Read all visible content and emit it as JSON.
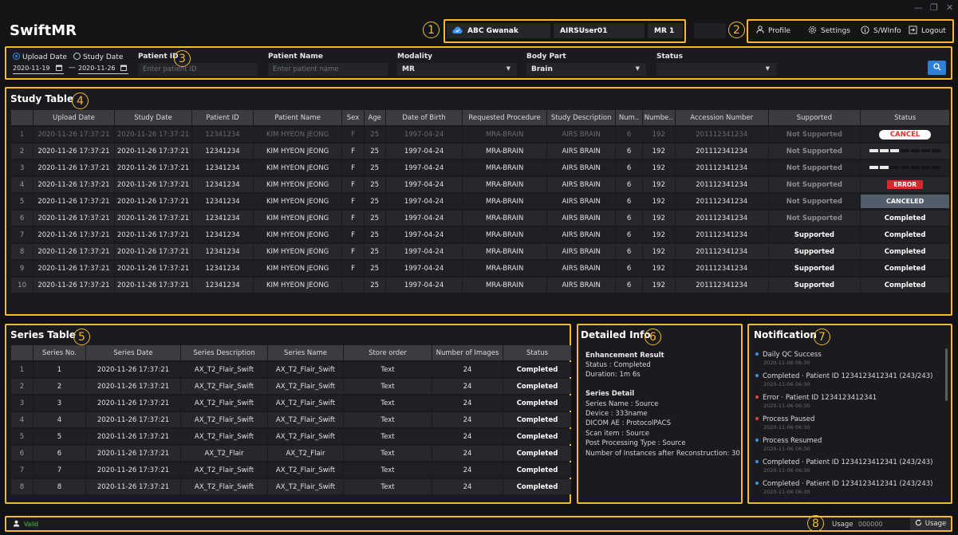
{
  "app": {
    "title": "SwiftMR"
  },
  "window": {
    "minimize": "—",
    "maximize": "❐",
    "close": "✕"
  },
  "header": {
    "hospital": "ABC Gwanak",
    "user": "AIRSUser01",
    "device": "MR 1",
    "profile": "Profile",
    "settings": "Settings",
    "swinfo": "S/WInfo",
    "logout": "Logout"
  },
  "callouts": [
    "1",
    "2",
    "3",
    "4",
    "5",
    "6",
    "7",
    "8"
  ],
  "filter": {
    "upload_date": "Upload Date",
    "study_date": "Study Date",
    "date_from": "2020-11-19",
    "date_to": "2020-11-26",
    "date_sep": "—",
    "patient_id_label": "Patient ID",
    "patient_id_placeholder": "Enter patient ID",
    "patient_name_label": "Patient Name",
    "patient_name_placeholder": "Enter patient name",
    "modality_label": "Modality",
    "modality_value": "MR",
    "body_part_label": "Body Part",
    "body_part_value": "Brain",
    "status_label": "Status",
    "status_value": ""
  },
  "study": {
    "title": "Study Table",
    "columns": [
      "",
      "Upload Date",
      "Study Date",
      "Patient ID",
      "Patient Name",
      "Sex",
      "Age",
      "Date of Birth",
      "Requested Procedure",
      "Study Description",
      "Num..",
      "Numbe..",
      "Accession Number",
      "Supported",
      "Status"
    ],
    "rows": [
      {
        "n": "1",
        "upload": "2020-11-26 17:37:21",
        "study": "2020-11-26 17:37:21",
        "pid": "12341234",
        "name": "KIM HYEON JEONG",
        "sex": "F",
        "age": "25",
        "dob": "1997-04-24",
        "proc": "MRA-BRAIN",
        "desc": "AIRS BRAIN",
        "num1": "6",
        "num2": "192",
        "acc": "201112341234",
        "supported": "Not Supported",
        "status": "CANCEL"
      },
      {
        "n": "2",
        "upload": "2020-11-26 17:37:21",
        "study": "2020-11-26 17:37:21",
        "pid": "12341234",
        "name": "KIM HYEON JEONG",
        "sex": "F",
        "age": "25",
        "dob": "1997-04-24",
        "proc": "MRA-BRAIN",
        "desc": "AIRS BRAIN",
        "num1": "6",
        "num2": "192",
        "acc": "201112341234",
        "supported": "Not Supported",
        "status": ""
      },
      {
        "n": "3",
        "upload": "2020-11-26 17:37:21",
        "study": "2020-11-26 17:37:21",
        "pid": "12341234",
        "name": "KIM HYEON JEONG",
        "sex": "F",
        "age": "25",
        "dob": "1997-04-24",
        "proc": "MRA-BRAIN",
        "desc": "AIRS BRAIN",
        "num1": "6",
        "num2": "192",
        "acc": "201112341234",
        "supported": "Not Supported",
        "status": ""
      },
      {
        "n": "4",
        "upload": "2020-11-26 17:37:21",
        "study": "2020-11-26 17:37:21",
        "pid": "12341234",
        "name": "KIM HYEON JEONG",
        "sex": "F",
        "age": "25",
        "dob": "1997-04-24",
        "proc": "MRA-BRAIN",
        "desc": "AIRS BRAIN",
        "num1": "6",
        "num2": "192",
        "acc": "201112341234",
        "supported": "Not Supported",
        "status": "ERROR"
      },
      {
        "n": "5",
        "upload": "2020-11-26 17:37:21",
        "study": "2020-11-26 17:37:21",
        "pid": "12341234",
        "name": "KIM HYEON JEONG",
        "sex": "F",
        "age": "25",
        "dob": "1997-04-24",
        "proc": "MRA-BRAIN",
        "desc": "AIRS BRAIN",
        "num1": "6",
        "num2": "192",
        "acc": "201112341234",
        "supported": "Not Supported",
        "status": "CANCELED"
      },
      {
        "n": "6",
        "upload": "2020-11-26 17:37:21",
        "study": "2020-11-26 17:37:21",
        "pid": "12341234",
        "name": "KIM HYEON JEONG",
        "sex": "F",
        "age": "25",
        "dob": "1997-04-24",
        "proc": "MRA-BRAIN",
        "desc": "AIRS BRAIN",
        "num1": "6",
        "num2": "192",
        "acc": "201112341234",
        "supported": "Not Supported",
        "status": "Completed"
      },
      {
        "n": "7",
        "upload": "2020-11-26 17:37:21",
        "study": "2020-11-26 17:37:21",
        "pid": "12341234",
        "name": "KIM HYEON JEONG",
        "sex": "F",
        "age": "25",
        "dob": "1997-04-24",
        "proc": "MRA-BRAIN",
        "desc": "AIRS BRAIN",
        "num1": "6",
        "num2": "192",
        "acc": "201112341234",
        "supported": "Supported",
        "status": "Completed"
      },
      {
        "n": "8",
        "upload": "2020-11-26 17:37:21",
        "study": "2020-11-26 17:37:21",
        "pid": "12341234",
        "name": "KIM HYEON JEONG",
        "sex": "F",
        "age": "25",
        "dob": "1997-04-24",
        "proc": "MRA-BRAIN",
        "desc": "AIRS BRAIN",
        "num1": "6",
        "num2": "192",
        "acc": "201112341234",
        "supported": "Supported",
        "status": "Completed"
      },
      {
        "n": "9",
        "upload": "2020-11-26 17:37:21",
        "study": "2020-11-26 17:37:21",
        "pid": "12341234",
        "name": "KIM HYEON JEONG",
        "sex": "F",
        "age": "25",
        "dob": "1997-04-24",
        "proc": "MRA-BRAIN",
        "desc": "AIRS BRAIN",
        "num1": "6",
        "num2": "192",
        "acc": "201112341234",
        "supported": "Supported",
        "status": "Completed"
      },
      {
        "n": "10",
        "upload": "2020-11-26 17:37:21",
        "study": "2020-11-26 17:37:21",
        "pid": "12341234",
        "name": "KIM HYEON JEONG",
        "sex": "",
        "age": "25",
        "dob": "1997-04-24",
        "proc": "MRA-BRAIN",
        "desc": "AIRS BRAIN",
        "num1": "6",
        "num2": "192",
        "acc": "201112341234",
        "supported": "Supported",
        "status": "Completed"
      }
    ],
    "progress": {
      "2": 0.4,
      "3": 0.25
    }
  },
  "series": {
    "title": "Series Table",
    "columns": [
      "",
      "Series No.",
      "Series Date",
      "Series Description",
      "Series Name",
      "Store order",
      "Number of Images",
      "Status"
    ],
    "rows": [
      {
        "n": "1",
        "no": "1",
        "date": "2020-11-26 17:37:21",
        "desc": "AX_T2_Flair_Swift",
        "name": "AX_T2_Flair_Swift",
        "order": "Text",
        "images": "24",
        "status": "Completed"
      },
      {
        "n": "2",
        "no": "2",
        "date": "2020-11-26 17:37:21",
        "desc": "AX_T2_Flair_Swift",
        "name": "AX_T2_Flair_Swift",
        "order": "Text",
        "images": "24",
        "status": "Completed"
      },
      {
        "n": "3",
        "no": "3",
        "date": "2020-11-26 17:37:21",
        "desc": "AX_T2_Flair_Swift",
        "name": "AX_T2_Flair_Swift",
        "order": "Text",
        "images": "24",
        "status": "Completed"
      },
      {
        "n": "4",
        "no": "4",
        "date": "2020-11-26 17:37:21",
        "desc": "AX_T2_Flair_Swift",
        "name": "AX_T2_Flair_Swift",
        "order": "Text",
        "images": "24",
        "status": "Completed"
      },
      {
        "n": "5",
        "no": "5",
        "date": "2020-11-26 17:37:21",
        "desc": "AX_T2_Flair_Swift",
        "name": "AX_T2_Flair_Swift",
        "order": "Text",
        "images": "24",
        "status": "Completed"
      },
      {
        "n": "6",
        "no": "6",
        "date": "2020-11-26 17:37:21",
        "desc": "AX_T2_Flair",
        "name": "AX_T2_Flair",
        "order": "Text",
        "images": "24",
        "status": "Completed"
      },
      {
        "n": "7",
        "no": "7",
        "date": "2020-11-26 17:37:21",
        "desc": "AX_T2_Flair_Swift",
        "name": "AX_T2_Flair_Swift",
        "order": "Text",
        "images": "24",
        "status": "Completed"
      },
      {
        "n": "8",
        "no": "8",
        "date": "2020-11-26 17:37:21",
        "desc": "AX_T2_Flair_Swift",
        "name": "AX_T2_Flair_Swift",
        "order": "Text",
        "images": "24",
        "status": "Completed"
      }
    ]
  },
  "detail": {
    "title": "Detailed Info",
    "enh_head": "Enhancement Result",
    "enh_status": "Status : Completed",
    "enh_duration": "Duration: 1m 6s",
    "series_head": "Series Detail",
    "series_name": "Series Name : Source",
    "device": "Device : 333name",
    "dicom_ae": "DICOM AE : ProtocolPACS",
    "scan_item": "Scan item : Source",
    "post_type": "Post Processing Type : Source",
    "instances": "Number of Instances after Reconstruction: 30"
  },
  "notification": {
    "title": "Notification",
    "items": [
      {
        "text": "Daily QC Success",
        "time": "2020-11-06 06:30",
        "color": "#3d8fe0"
      },
      {
        "text": "Completed · Patient ID 1234123412341 (243/243)",
        "time": "2020-11-06 06:30",
        "color": "#3d8fe0"
      },
      {
        "text": "Error · Patient ID 1234123412341",
        "time": "2020-11-06 06:30",
        "color": "#e0443e"
      },
      {
        "text": "Process Paused",
        "time": "2020-11-06 06:30",
        "color": "#e0443e"
      },
      {
        "text": "Process Resumed",
        "time": "2020-11-06 06:30",
        "color": "#3d8fe0"
      },
      {
        "text": "Completed · Patient ID 1234123412341 (243/243)",
        "time": "2020-11-06 06:30",
        "color": "#3d8fe0"
      },
      {
        "text": "Completed · Patient ID 1234123412341 (243/243)",
        "time": "2020-11-06 06:30",
        "color": "#3d8fe0"
      }
    ]
  },
  "statusbar": {
    "license": "Valid",
    "usage_label": "Usage",
    "usage_value": "000000",
    "usage_button": "Usage"
  },
  "colors": {
    "accent": "#f5b82e",
    "primary": "#2f7fd6",
    "error": "#d22b2b"
  }
}
